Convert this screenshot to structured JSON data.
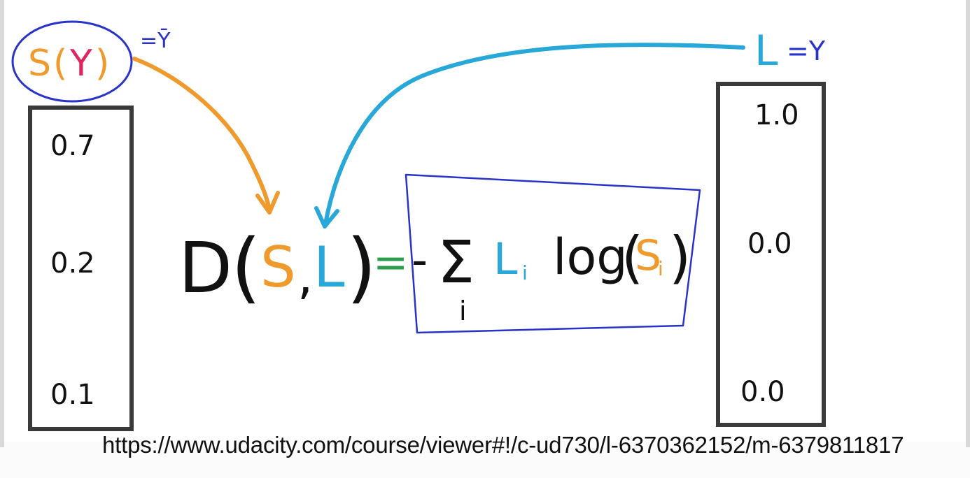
{
  "colors": {
    "ink": "#111111",
    "orange": "#ef9a2c",
    "red": "#e0245e",
    "cyan": "#27a8d8",
    "blue": "#2a33c9",
    "green": "#2a9d4a"
  },
  "left_label": {
    "s": "S",
    "open": "(",
    "y": "Y",
    "close": ")",
    "annotation": "=Ȳ"
  },
  "right_label": {
    "l": "L",
    "annotation": "=Y"
  },
  "left_vector": {
    "values": [
      "0.7",
      "0.2",
      "0.1"
    ]
  },
  "right_vector": {
    "values": [
      "1.0",
      "0.0",
      "0.0"
    ]
  },
  "equation": {
    "d": "D",
    "open": "(",
    "s": "S",
    "comma": ",",
    "l": "L",
    "close": ")",
    "equals": "=",
    "minus": "-",
    "sigma": "Σ",
    "index": "i",
    "l_i": "L",
    "l_sub": "i",
    "log": "log",
    "open2": "(",
    "s_i": "S",
    "s_sub": "i",
    "close2": ")"
  },
  "caption": "https://www.udacity.com/course/viewer#!/c-ud730/l-6370362152/m-6379811817"
}
